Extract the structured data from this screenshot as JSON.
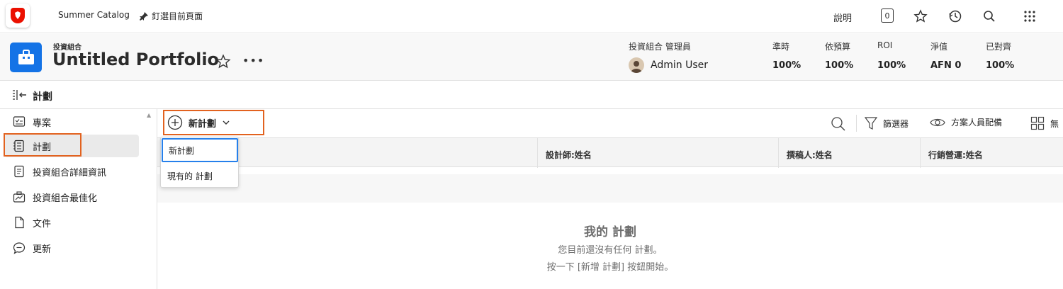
{
  "topbar": {
    "brand_mark": "Adobe-style red logo",
    "catalog_link": "Summer Catalog",
    "pin_link": "釘選目前頁面",
    "help": "說明",
    "notification_count": "0",
    "icons": [
      "star-icon",
      "history-icon",
      "search-icon",
      "app-grid-icon"
    ]
  },
  "header": {
    "kicker": "投資組合",
    "title": "Untitled Portfolio",
    "more": "•••",
    "manager_label": "投資組合 管理員",
    "manager_name": "Admin User",
    "metrics": [
      {
        "label": "準時",
        "value": "100%"
      },
      {
        "label": "依預算",
        "value": "100%"
      },
      {
        "label": "ROI",
        "value": "100%"
      },
      {
        "label": "淨值",
        "value": "AFN 0"
      },
      {
        "label": "已對齊",
        "value": "100%"
      }
    ]
  },
  "subheader": {
    "title": "計劃"
  },
  "sidebar": {
    "items": [
      {
        "label": "專案",
        "icon": "project-icon"
      },
      {
        "label": "計劃",
        "icon": "program-icon",
        "active": true
      },
      {
        "label": "投資組合詳細資訊",
        "icon": "details-icon"
      },
      {
        "label": "投資組合最佳化",
        "icon": "optimizer-icon"
      },
      {
        "label": "文件",
        "icon": "document-icon"
      },
      {
        "label": "更新",
        "icon": "updates-icon"
      }
    ]
  },
  "toolbar": {
    "new_plan": "新計劃",
    "filter": "篩選器",
    "view": "方案人員配備",
    "grouping": "無"
  },
  "dropdown": {
    "items": [
      "新計劃",
      "現有的 計劃"
    ]
  },
  "table": {
    "columns": [
      "設計師:姓名",
      "撰稿人:姓名",
      "行銷營運:姓名"
    ]
  },
  "empty_state": {
    "title": "我的 計劃",
    "line1": "您目前還沒有任何 計劃。",
    "line2": "按一下 [新增 計劃] 按鈕開始。"
  },
  "colors": {
    "accent": "#1473e6",
    "highlight": "#e2621f",
    "brand_red": "#eb1000"
  }
}
